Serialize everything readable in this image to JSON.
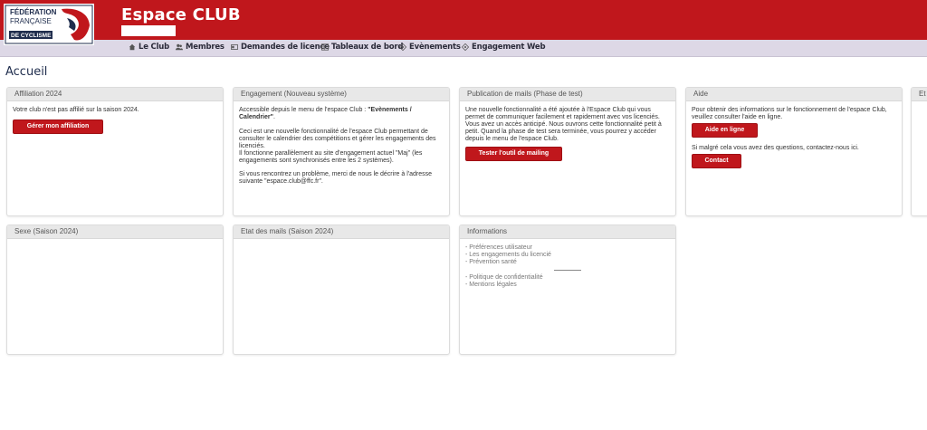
{
  "header": {
    "logo": {
      "line1": "FÉDÉRATION",
      "line2": "FRANÇAISE",
      "line3": "DE CYCLISME"
    },
    "title": "Espace CLUB"
  },
  "nav": [
    {
      "label": "Le Club",
      "icon": "home-icon"
    },
    {
      "label": "Membres",
      "icon": "users-icon"
    },
    {
      "label": "Demandes de licence",
      "icon": "card-icon"
    },
    {
      "label": "Tableaux de bord",
      "icon": "table-icon"
    },
    {
      "label": "Evènements",
      "icon": "target-icon"
    },
    {
      "label": "Engagement Web",
      "icon": "target-icon"
    }
  ],
  "page_title": "Accueil",
  "panels": {
    "affiliation": {
      "title": "Affiliation 2024",
      "text": "Votre club n'est pas affilié sur la saison 2024.",
      "button": "Gérer mon affiliation"
    },
    "engagement": {
      "title": "Engagement (Nouveau système)",
      "intro": "Accessible depuis le menu de l'espace Club : ",
      "intro_bold": "\"Evènements / Calendrier\"",
      "intro_end": ".",
      "para2": "Ceci est une nouvelle fonctionnalité de l'espace Club permettant de consulter le calendrier des compétitions et gérer les engagements des licenciés.",
      "para3": "Il fonctionne parallèlement au site d'engagement actuel \"Maj\" (les engagements sont synchronisés entre les 2 systèmes).",
      "para4": "Si vous rencontrez un problème, merci de nous le décrire à l'adresse suivante \"espace.club@ffc.fr\"."
    },
    "mailing": {
      "title": "Publication de mails (Phase de test)",
      "para1": "Une nouvelle fonctionnalité a été ajoutée à l'Espace Club qui vous permet de communiquer facilement et rapidement avec vos licenciés.",
      "para2": "Vous avez un accès anticipé. Nous ouvrons cette fonctionnalité petit à petit. Quand la phase de test sera terminée, vous pourrez y accéder depuis le menu de l'espace Club.",
      "button": "Tester l'outil de mailing"
    },
    "aide": {
      "title": "Aide",
      "para1": "Pour obtenir des informations sur le fonctionnement de l'espace Club, veuillez consulter l'aide en ligne.",
      "button1": "Aide en ligne",
      "para2": "Si malgré cela vous avez des questions, contactez-nous ici.",
      "button2": "Contact"
    },
    "partial": {
      "title": "Et"
    },
    "sexe": {
      "title": "Sexe (Saison 2024)"
    },
    "mails": {
      "title": "Etat des mails (Saison 2024)"
    },
    "informations": {
      "title": "Informations",
      "links1": [
        "- Préférences utilisateur",
        "- Les engagements du licencié",
        "- Prévention santé"
      ],
      "links2": [
        "- Politique de confidentialité",
        "- Mentions légales"
      ]
    }
  },
  "colors": {
    "brand_red": "#c0171c",
    "nav_bg": "#ddd8e6",
    "navy": "#1f2d4d"
  }
}
